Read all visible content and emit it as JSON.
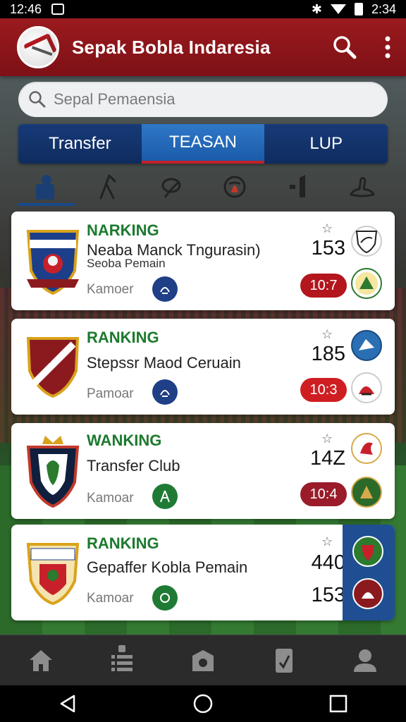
{
  "status_bar": {
    "time_left": "12:46",
    "time_right": "2:34"
  },
  "app": {
    "title": "Sepak Bobla Indaresia"
  },
  "search": {
    "placeholder": "Sepal Pemaensia"
  },
  "tabs": [
    {
      "label": "Transfer",
      "active": false
    },
    {
      "label": "TEASAN",
      "active": true
    },
    {
      "label": "LUP",
      "active": false
    }
  ],
  "category_icons": [
    "player-icon",
    "boot-icon",
    "ball-icon",
    "trophy-icon",
    "stats-icon",
    "whistle-icon"
  ],
  "cards": [
    {
      "ranking": "NARKING",
      "name": "Neaba Manck Tngurasin)",
      "subtitle": "Seoba Pemain",
      "label": "Kamoer",
      "score": "153",
      "pill": "10:7",
      "pill_color": "#b3161d"
    },
    {
      "ranking": "RANKING",
      "name": "Stepssr Maod Ceruain",
      "subtitle": "",
      "label": "Pamoar",
      "score": "185",
      "pill": "10:3",
      "pill_color": "#cf1e22"
    },
    {
      "ranking": "WANKING",
      "name": "Transfer Club",
      "subtitle": "",
      "label": "Kamoar",
      "score": "14Z",
      "pill": "10:4",
      "pill_color": "#9a1c2a"
    },
    {
      "ranking": "RANKING",
      "name": "Gepaffer Kobla Pemain",
      "subtitle": "",
      "label": "Kamoar",
      "score": "440",
      "score2": "153"
    }
  ],
  "bottom_nav": [
    "home-icon",
    "list-icon",
    "camera-icon",
    "card-icon",
    "profile-icon"
  ],
  "colors": {
    "brand_red": "#8c1419",
    "tab_blue": "#173a78",
    "tab_active": "#2f78c8",
    "ranking_green": "#1c7a2e"
  }
}
